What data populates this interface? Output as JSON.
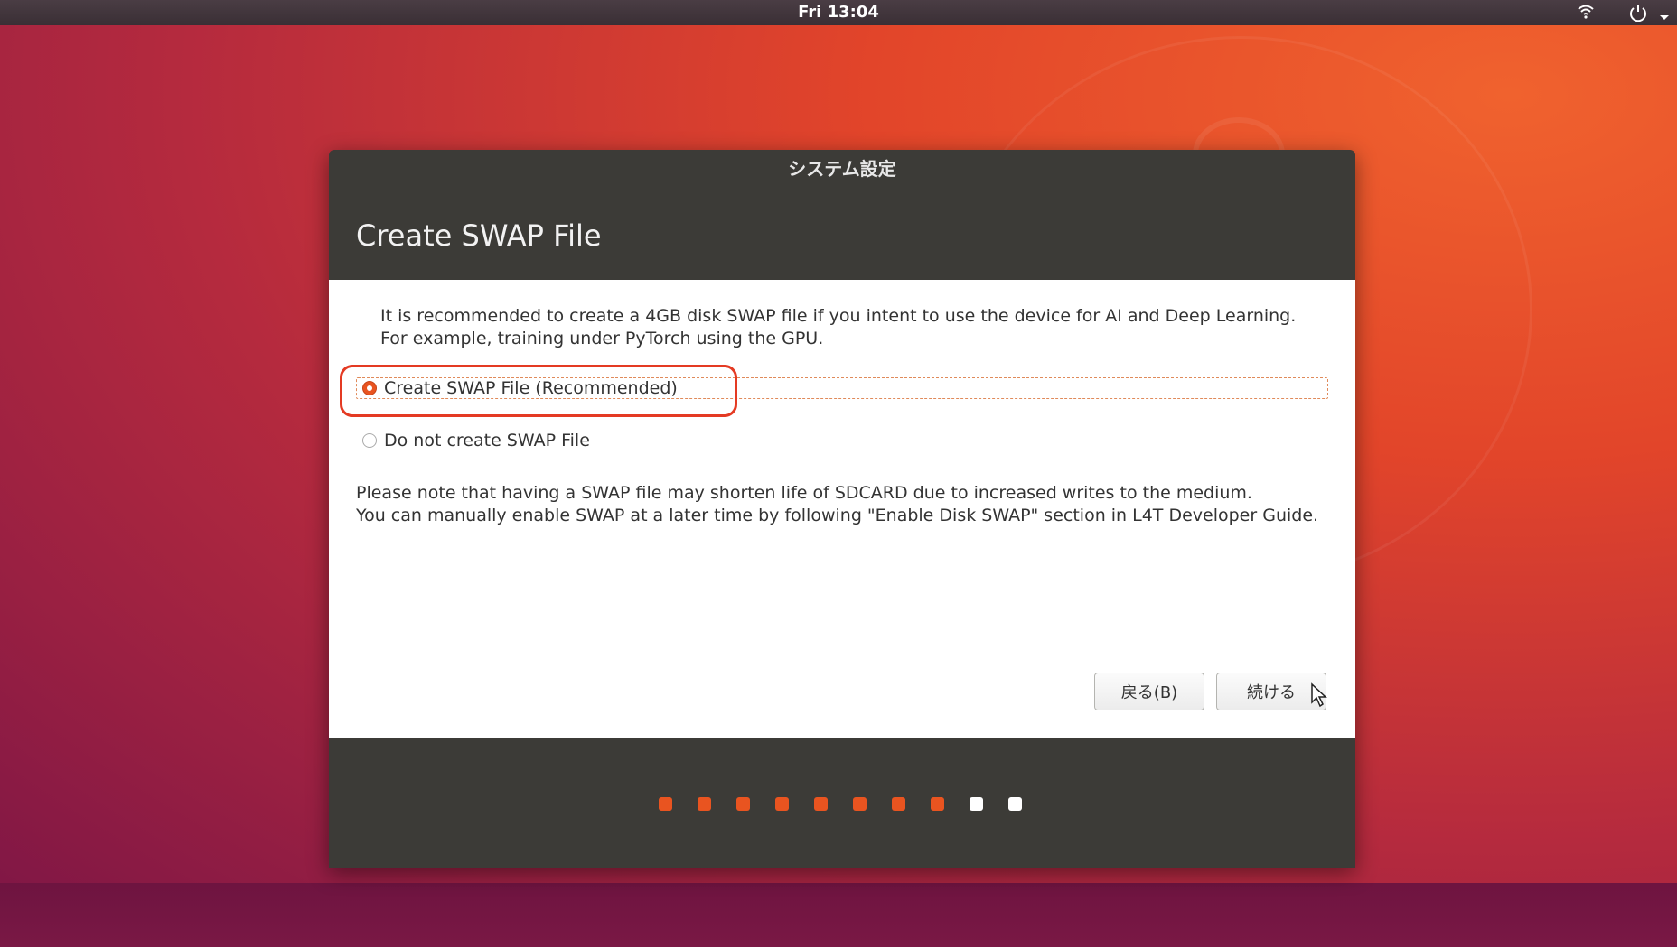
{
  "topbar": {
    "clock": "Fri 13:04",
    "icons": [
      "wifi-icon",
      "power-icon",
      "chevron-down-icon"
    ]
  },
  "dialog": {
    "window_title": "システム設定",
    "header_title": "Create SWAP File",
    "intro_line1": "It is recommended to create a 4GB disk SWAP file if you intent to use the device for AI and Deep Learning.",
    "intro_line2": "For example, training under PyTorch using the GPU.",
    "options": [
      {
        "label": "Create SWAP File (Recommended)",
        "selected": true
      },
      {
        "label": "Do not create SWAP File",
        "selected": false
      }
    ],
    "note_line1": "Please note that having a SWAP file may shorten life of SDCARD due to increased writes to the medium.",
    "note_line2": "You can manually enable SWAP at a later time by following \"Enable Disk SWAP\" section in L4T Developer Guide.",
    "back_label": "戻る(B)",
    "next_label": "続ける"
  },
  "progress": {
    "total_steps": 10,
    "completed_steps": 8
  },
  "colors": {
    "accent": "#e95420",
    "dialog_dark": "#3c3b37",
    "highlight": "#e43a23",
    "dot_done": "#e95420",
    "dot_pending": "#ffffff"
  }
}
